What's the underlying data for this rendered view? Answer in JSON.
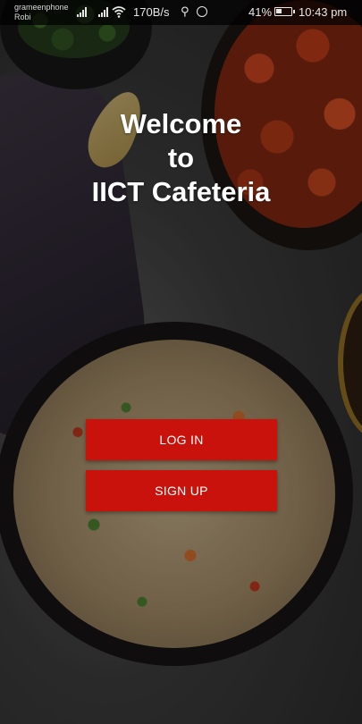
{
  "status_bar": {
    "carrier_primary": "grameenphone",
    "carrier_secondary": "Robi",
    "network_speed": "170B/s",
    "usb_icon": "usb-icon",
    "messenger_icon": "messenger-icon",
    "battery_percent": "41%",
    "battery_level": 0.41,
    "time": "10:43 pm"
  },
  "welcome": {
    "line1": "Welcome",
    "line2": "to",
    "line3": "IICT Cafeteria"
  },
  "actions": {
    "login_label": "LOG IN",
    "signup_label": "SIGN UP"
  },
  "colors": {
    "button_bg": "#c8120b",
    "text": "#ffffff"
  }
}
